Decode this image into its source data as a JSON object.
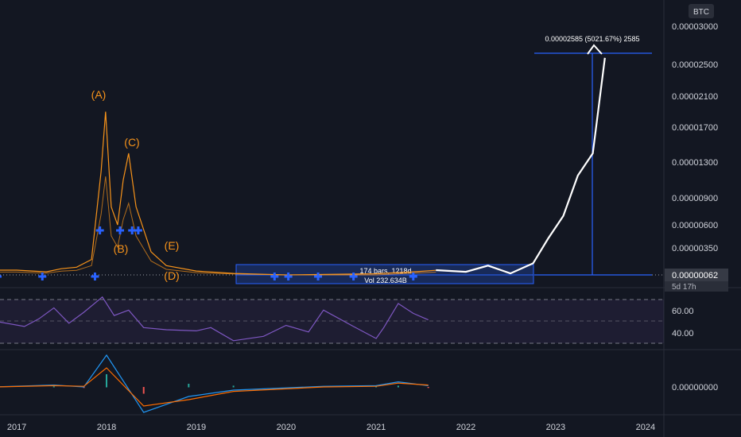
{
  "chart_data": [
    {
      "type": "line",
      "panel": "price",
      "currency_badge": "BTC",
      "price_axis_ticks": [
        "0.00003000",
        "0.00002500",
        "0.00002100",
        "0.00001700",
        "0.00001300",
        "0.00000900",
        "0.00000600",
        "0.00000350"
      ],
      "last_price_label": "0.00000062",
      "countdown_label": "5d 17h",
      "series": [
        {
          "values": [
            [
              "2016-10-01",
              6.2e-07
            ],
            [
              "2017-01-01",
              6.2e-07
            ],
            [
              "2017-05-01",
              4e-07
            ],
            [
              "2017-07-01",
              8e-07
            ],
            [
              "2017-09-01",
              1e-06
            ],
            [
              "2017-11-01",
              2e-06
            ],
            [
              "2017-12-10",
              1.2e-05
            ],
            [
              "2017-12-28",
              1.9e-05
            ],
            [
              "2018-01-20",
              8e-06
            ],
            [
              "2018-02-15",
              6e-06
            ],
            [
              "2018-03-10",
              1.1e-05
            ],
            [
              "2018-04-01",
              1.4e-05
            ],
            [
              "2018-05-01",
              8e-06
            ],
            [
              "2018-07-01",
              3e-06
            ],
            [
              "2018-09-01",
              1.2e-06
            ],
            [
              "2019-01-01",
              5e-07
            ],
            [
              "2019-06-01",
              2e-07
            ],
            [
              "2020-01-01",
              1e-07
            ],
            [
              "2021-01-01",
              1.5e-07
            ],
            [
              "2021-06-01",
              4e-07
            ],
            [
              "2021-09-01",
              6e-07
            ]
          ]
        },
        {
          "values": [
            [
              "2021-09-01",
              6.2e-07
            ],
            [
              "2022-01-01",
              4e-07
            ],
            [
              "2022-04-01",
              1.2e-06
            ],
            [
              "2022-07-01",
              2e-07
            ],
            [
              "2022-10-01",
              1.5e-06
            ],
            [
              "2022-12-01",
              4.5e-06
            ],
            [
              "2023-02-01",
              7e-06
            ],
            [
              "2023-04-01",
              1.15e-05
            ],
            [
              "2023-06-01",
              1.4e-05
            ],
            [
              "2023-07-20",
              2.585e-05
            ]
          ]
        }
      ],
      "wave_labels": [
        "(A)",
        "(B)",
        "(C)",
        "(D)",
        "(E)"
      ],
      "measure_label": "0.00002585 (5021.67%) 2585",
      "range_label_1": "174 bars, 1218d",
      "range_label_2": "Vol 232.634B"
    },
    {
      "type": "line",
      "panel": "rsi",
      "price_axis_ticks": [
        "60.00",
        "40.00"
      ],
      "series": [
        {
          "values": [
            [
              "2016-10-01",
              50
            ],
            [
              "2017-02-01",
              45
            ],
            [
              "2017-04-01",
              52
            ],
            [
              "2017-06-01",
              62
            ],
            [
              "2017-08-01",
              48
            ],
            [
              "2017-10-01",
              58
            ],
            [
              "2017-12-15",
              72
            ],
            [
              "2018-02-01",
              55
            ],
            [
              "2018-04-01",
              60
            ],
            [
              "2018-06-01",
              44
            ],
            [
              "2018-09-01",
              42
            ],
            [
              "2019-01-01",
              41
            ],
            [
              "2019-03-01",
              44
            ],
            [
              "2019-06-01",
              32
            ],
            [
              "2019-10-01",
              36
            ],
            [
              "2020-01-01",
              46
            ],
            [
              "2020-04-01",
              40
            ],
            [
              "2020-06-01",
              60
            ],
            [
              "2020-10-01",
              45
            ],
            [
              "2021-01-01",
              34
            ],
            [
              "2021-02-01",
              44
            ],
            [
              "2021-04-01",
              66
            ],
            [
              "2021-06-01",
              57
            ],
            [
              "2021-08-01",
              51
            ]
          ]
        }
      ]
    },
    {
      "type": "line",
      "panel": "macd",
      "price_axis_ticks": [
        "0.00000000"
      ],
      "series": [
        {
          "values": [
            [
              "2016-10-01",
              0
            ],
            [
              "2017-06-01",
              0.3
            ],
            [
              "2017-10-01",
              0
            ],
            [
              "2018-01-01",
              5
            ],
            [
              "2018-06-01",
              -4
            ],
            [
              "2018-12-01",
              -1.5
            ],
            [
              "2019-06-01",
              -0.5
            ],
            [
              "2020-06-01",
              0.1
            ],
            [
              "2021-01-01",
              0.2
            ],
            [
              "2021-04-01",
              0.8
            ],
            [
              "2021-08-01",
              0.2
            ]
          ]
        },
        {
          "values": [
            [
              "2016-10-01",
              0
            ],
            [
              "2017-06-01",
              0.2
            ],
            [
              "2017-10-01",
              0.1
            ],
            [
              "2018-01-01",
              3
            ],
            [
              "2018-06-01",
              -3
            ],
            [
              "2018-12-01",
              -2
            ],
            [
              "2019-06-01",
              -0.7
            ],
            [
              "2020-06-01",
              0
            ],
            [
              "2021-01-01",
              0.1
            ],
            [
              "2021-04-01",
              0.6
            ],
            [
              "2021-08-01",
              0.3
            ]
          ]
        }
      ]
    }
  ],
  "time_axis": {
    "ticks": [
      "2017",
      "2018",
      "2019",
      "2020",
      "2021",
      "2022",
      "2023",
      "2024"
    ]
  },
  "colors": {
    "bg": "#131722",
    "text": "#d1d4dc",
    "orange": "#f7931a",
    "blue": "#2962ff",
    "purple": "#7e57c2",
    "white": "#ffffff",
    "macd_blue": "#2196f3",
    "macd_orange": "#ff6d00"
  }
}
